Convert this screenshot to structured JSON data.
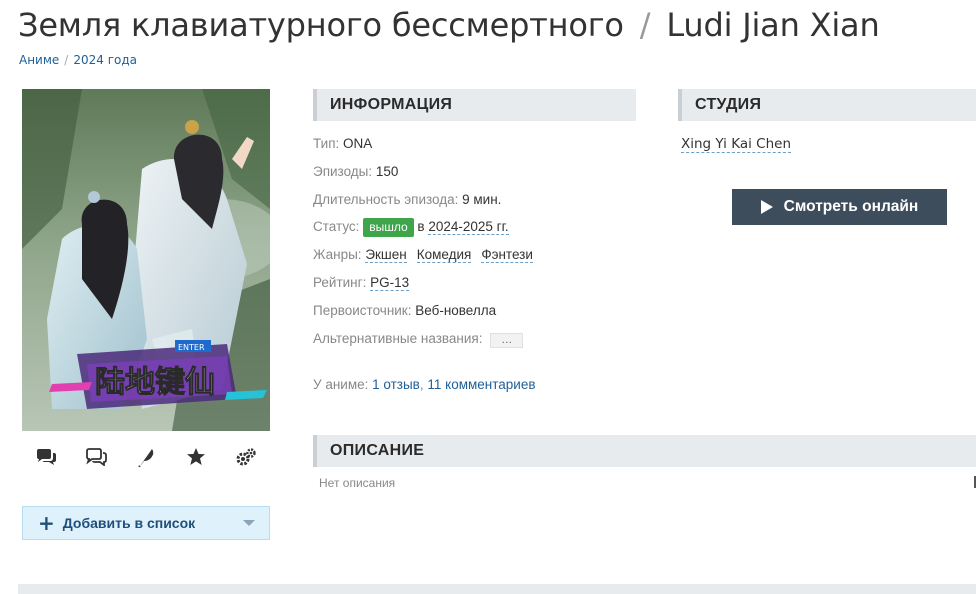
{
  "header": {
    "title_ru": "Земля клавиатурного бессмертного",
    "separator": "/",
    "title_orig": "Ludi Jian Xian"
  },
  "breadcrumbs": [
    {
      "label": "Аниме"
    },
    {
      "label": "2024 года"
    }
  ],
  "poster": {
    "logo_text": "陆地键仙",
    "logo_badge": "ENTER"
  },
  "actions": [
    {
      "icon": "comments-icon"
    },
    {
      "icon": "discussion-icon"
    },
    {
      "icon": "feather-icon"
    },
    {
      "icon": "star-icon"
    },
    {
      "icon": "gears-icon"
    }
  ],
  "add_to_list": {
    "label": "Добавить в список"
  },
  "info": {
    "heading": "ИНФОРМАЦИЯ",
    "type_key": "Тип:",
    "type_val": "ONA",
    "episodes_key": "Эпизоды:",
    "episodes_val": "150",
    "duration_key": "Длительность эпизода:",
    "duration_val": "9 мин.",
    "status_key": "Статус:",
    "status_badge": "вышло",
    "status_in": "в",
    "status_years": "2024-2025 гг.",
    "genres_key": "Жанры:",
    "genres": [
      "Экшен",
      "Комедия",
      "Фэнтези"
    ],
    "rating_key": "Рейтинг:",
    "rating_val": "PG-13",
    "source_key": "Первоисточник:",
    "source_val": "Веб-новелла",
    "alt_key": "Альтернативные названия:",
    "alt_val": "…",
    "about_key": "У аниме:",
    "reviews": "1 отзыв",
    "comma": ",",
    "comments": "11 комментариев"
  },
  "studio": {
    "heading": "СТУДИЯ",
    "name": "Xing Yi Kai Chen"
  },
  "watch": {
    "label": "Смотреть онлайн"
  },
  "description": {
    "heading": "ОПИСАНИЕ",
    "text": "Нет описания"
  },
  "colors": {
    "accent": "#1f5f9a",
    "status_green": "#3fa54b",
    "watch_bg": "#3d4d5c",
    "section_bg": "#e8ebee",
    "add_bg": "#dff1fb"
  }
}
